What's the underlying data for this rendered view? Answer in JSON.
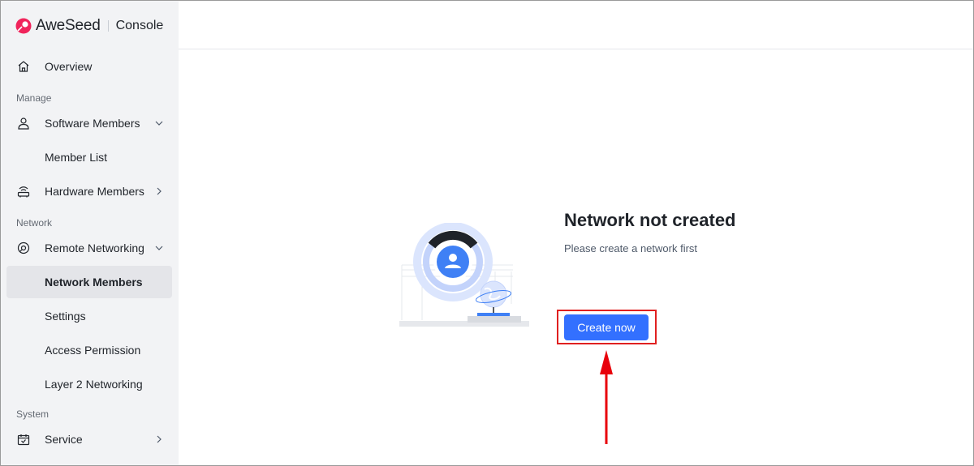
{
  "brand": {
    "name": "AweSeed",
    "console": "Console"
  },
  "sidebar": {
    "overview": "Overview",
    "sections": {
      "manage": "Manage",
      "network": "Network",
      "system": "System"
    },
    "software_members": "Software Members",
    "member_list": "Member List",
    "hardware_members": "Hardware Members",
    "remote_networking": "Remote Networking",
    "network_members": "Network Members",
    "settings": "Settings",
    "access_permission": "Access Permission",
    "layer2_networking": "Layer 2 Networking",
    "service": "Service",
    "active_item": "Network Members"
  },
  "empty_state": {
    "title": "Network not created",
    "description": "Please create a network first",
    "button": "Create now"
  },
  "colors": {
    "accent": "#3370ff",
    "brand": "#f0245b",
    "annotation": "#e02020",
    "sidebar_bg": "#f2f3f5"
  },
  "icons": [
    "brand-logo-icon",
    "home-icon",
    "user-icon",
    "router-icon",
    "network-icon",
    "service-icon",
    "chevron-down-icon",
    "chevron-right-icon"
  ]
}
